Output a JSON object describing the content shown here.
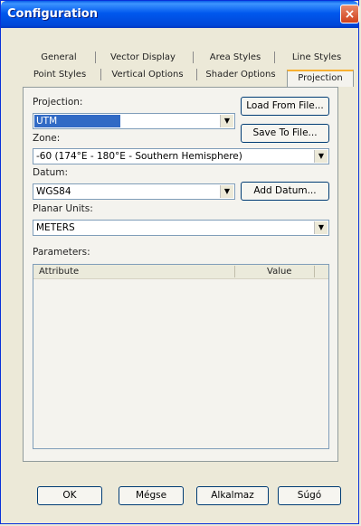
{
  "window": {
    "title": "Configuration",
    "close_icon": "×"
  },
  "tabs_row1": [
    "General",
    "Vector Display",
    "Area Styles",
    "Line Styles"
  ],
  "tabs_row2": [
    "Point Styles",
    "Vertical Options",
    "Shader Options",
    "Projection"
  ],
  "active_tab": "Projection",
  "projection": {
    "label": "Projection:",
    "value": "UTM",
    "load_button": "Load From File...",
    "save_button": "Save To File..."
  },
  "zone": {
    "label": "Zone:",
    "value": "-60 (174°E - 180°E - Southern Hemisphere)"
  },
  "datum": {
    "label": "Datum:",
    "value": "WGS84",
    "add_button": "Add Datum..."
  },
  "planar_units": {
    "label": "Planar Units:",
    "value": "METERS"
  },
  "parameters": {
    "label": "Parameters:",
    "columns": [
      "Attribute",
      "Value"
    ],
    "rows": []
  },
  "footer_buttons": {
    "ok": "OK",
    "cancel": "Mégse",
    "apply": "Alkalmaz",
    "help": "Súgó"
  },
  "colors": {
    "titlebar": "#0058ee",
    "selection": "#316ac5",
    "active_tab_highlight": "#f8b030"
  }
}
